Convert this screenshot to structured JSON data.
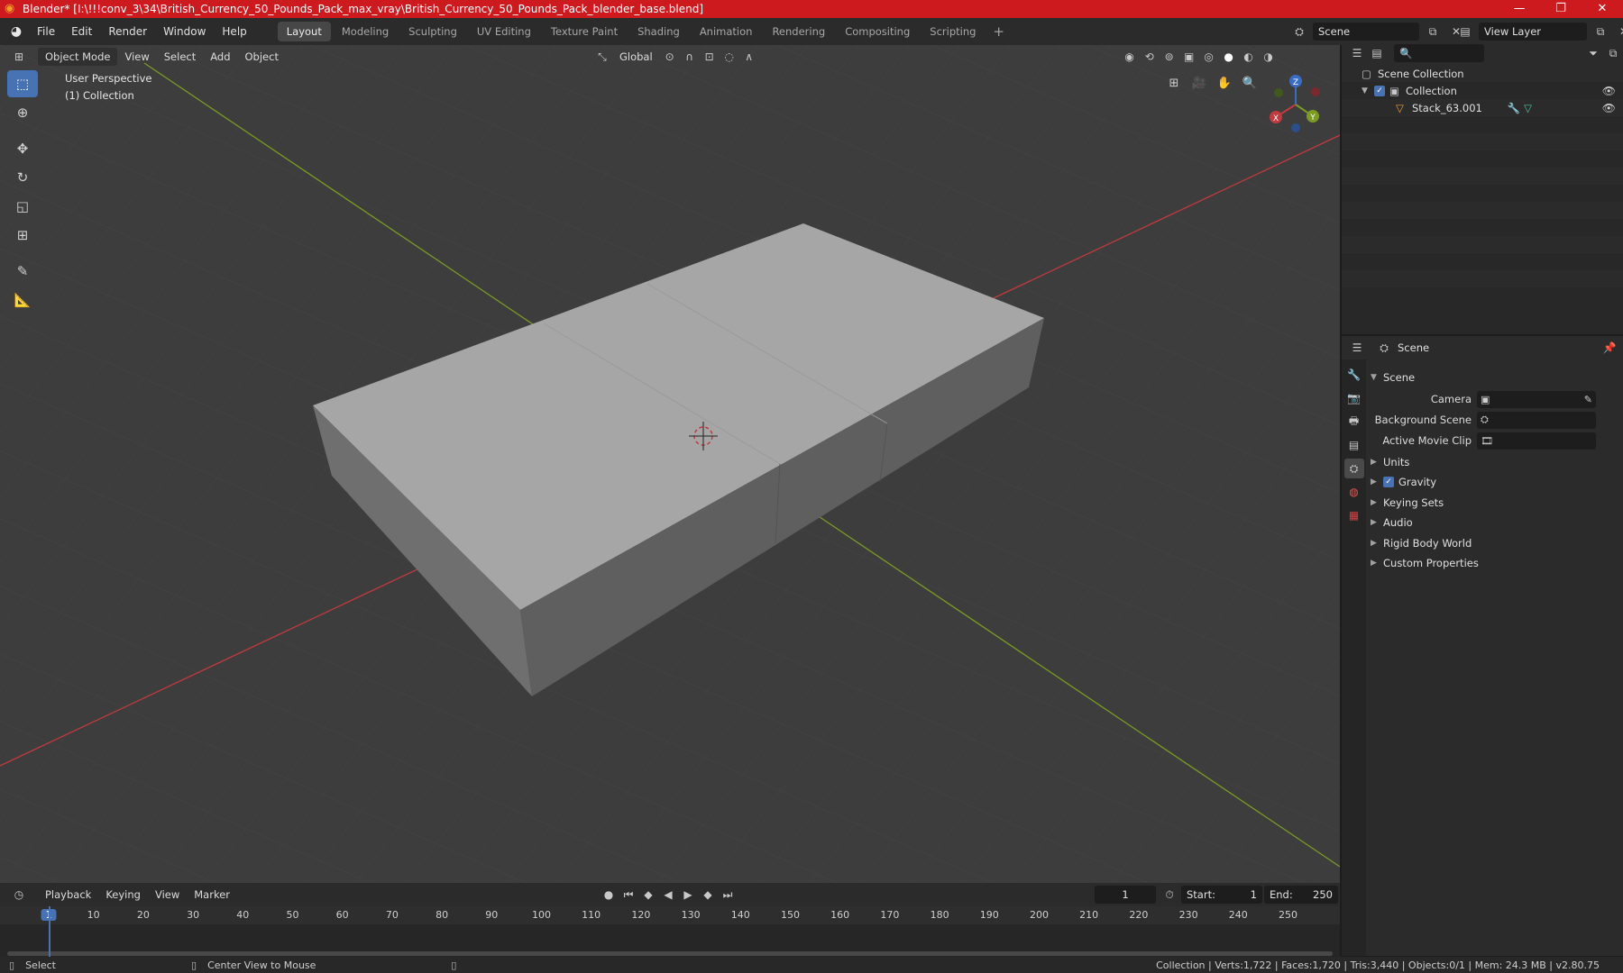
{
  "window": {
    "title": "Blender* [I:\\!!!conv_3\\34\\British_Currency_50_Pounds_Pack_max_vray\\British_Currency_50_Pounds_Pack_blender_base.blend]",
    "controls": [
      "—",
      "❐",
      "✕"
    ]
  },
  "menu": [
    "File",
    "Edit",
    "Render",
    "Window",
    "Help"
  ],
  "workspaces": [
    "Layout",
    "Modeling",
    "Sculpting",
    "UV Editing",
    "Texture Paint",
    "Shading",
    "Animation",
    "Rendering",
    "Compositing",
    "Scripting"
  ],
  "active_workspace": "Layout",
  "scene_selector": {
    "value": "Scene"
  },
  "view_layer_selector": {
    "value": "View Layer"
  },
  "viewport_header": {
    "mode": "Object Mode",
    "menus": [
      "View",
      "Select",
      "Add",
      "Object"
    ],
    "orientation": "Global"
  },
  "viewport": {
    "perspective_label": "User Perspective",
    "collection_label": "(1) Collection",
    "gizmo_axes": {
      "x": "X",
      "y": "Y",
      "z": "Z"
    },
    "colors": {
      "background": "#3d3d3d",
      "x_axis": "#c03a3f",
      "y_axis": "#7b9b22",
      "grid": "#474747",
      "accent": "#4772b3"
    }
  },
  "outliner": {
    "rows": [
      {
        "label": "Scene Collection"
      },
      {
        "label": "Collection"
      },
      {
        "label": "Stack_63.001"
      }
    ]
  },
  "properties": {
    "context": "Scene",
    "panel_title": "Scene",
    "fields": [
      {
        "label": "Camera"
      },
      {
        "label": "Background Scene"
      },
      {
        "label": "Active Movie Clip"
      }
    ],
    "panels": [
      {
        "label": "Units",
        "checkbox": false
      },
      {
        "label": "Gravity",
        "checkbox": true
      },
      {
        "label": "Keying Sets",
        "checkbox": false
      },
      {
        "label": "Audio",
        "checkbox": false
      },
      {
        "label": "Rigid Body World",
        "checkbox": false
      },
      {
        "label": "Custom Properties",
        "checkbox": false
      }
    ]
  },
  "timeline": {
    "menus": [
      "Playback",
      "Keying",
      "View",
      "Marker"
    ],
    "current_frame": "1",
    "start_label": "Start:",
    "start": "1",
    "end_label": "End:",
    "end": "250",
    "ticks": [
      "1",
      "10",
      "20",
      "30",
      "40",
      "50",
      "60",
      "70",
      "80",
      "90",
      "100",
      "110",
      "120",
      "130",
      "140",
      "150",
      "160",
      "170",
      "180",
      "190",
      "200",
      "210",
      "220",
      "230",
      "240",
      "250"
    ]
  },
  "statusbar": {
    "left_action": "Select",
    "middle_action": "Center View to Mouse",
    "stats": "Collection | Verts:1,722 | Faces:1,720 | Tris:3,440 | Objects:0/1 | Mem: 24.3 MB | v2.80.75"
  }
}
